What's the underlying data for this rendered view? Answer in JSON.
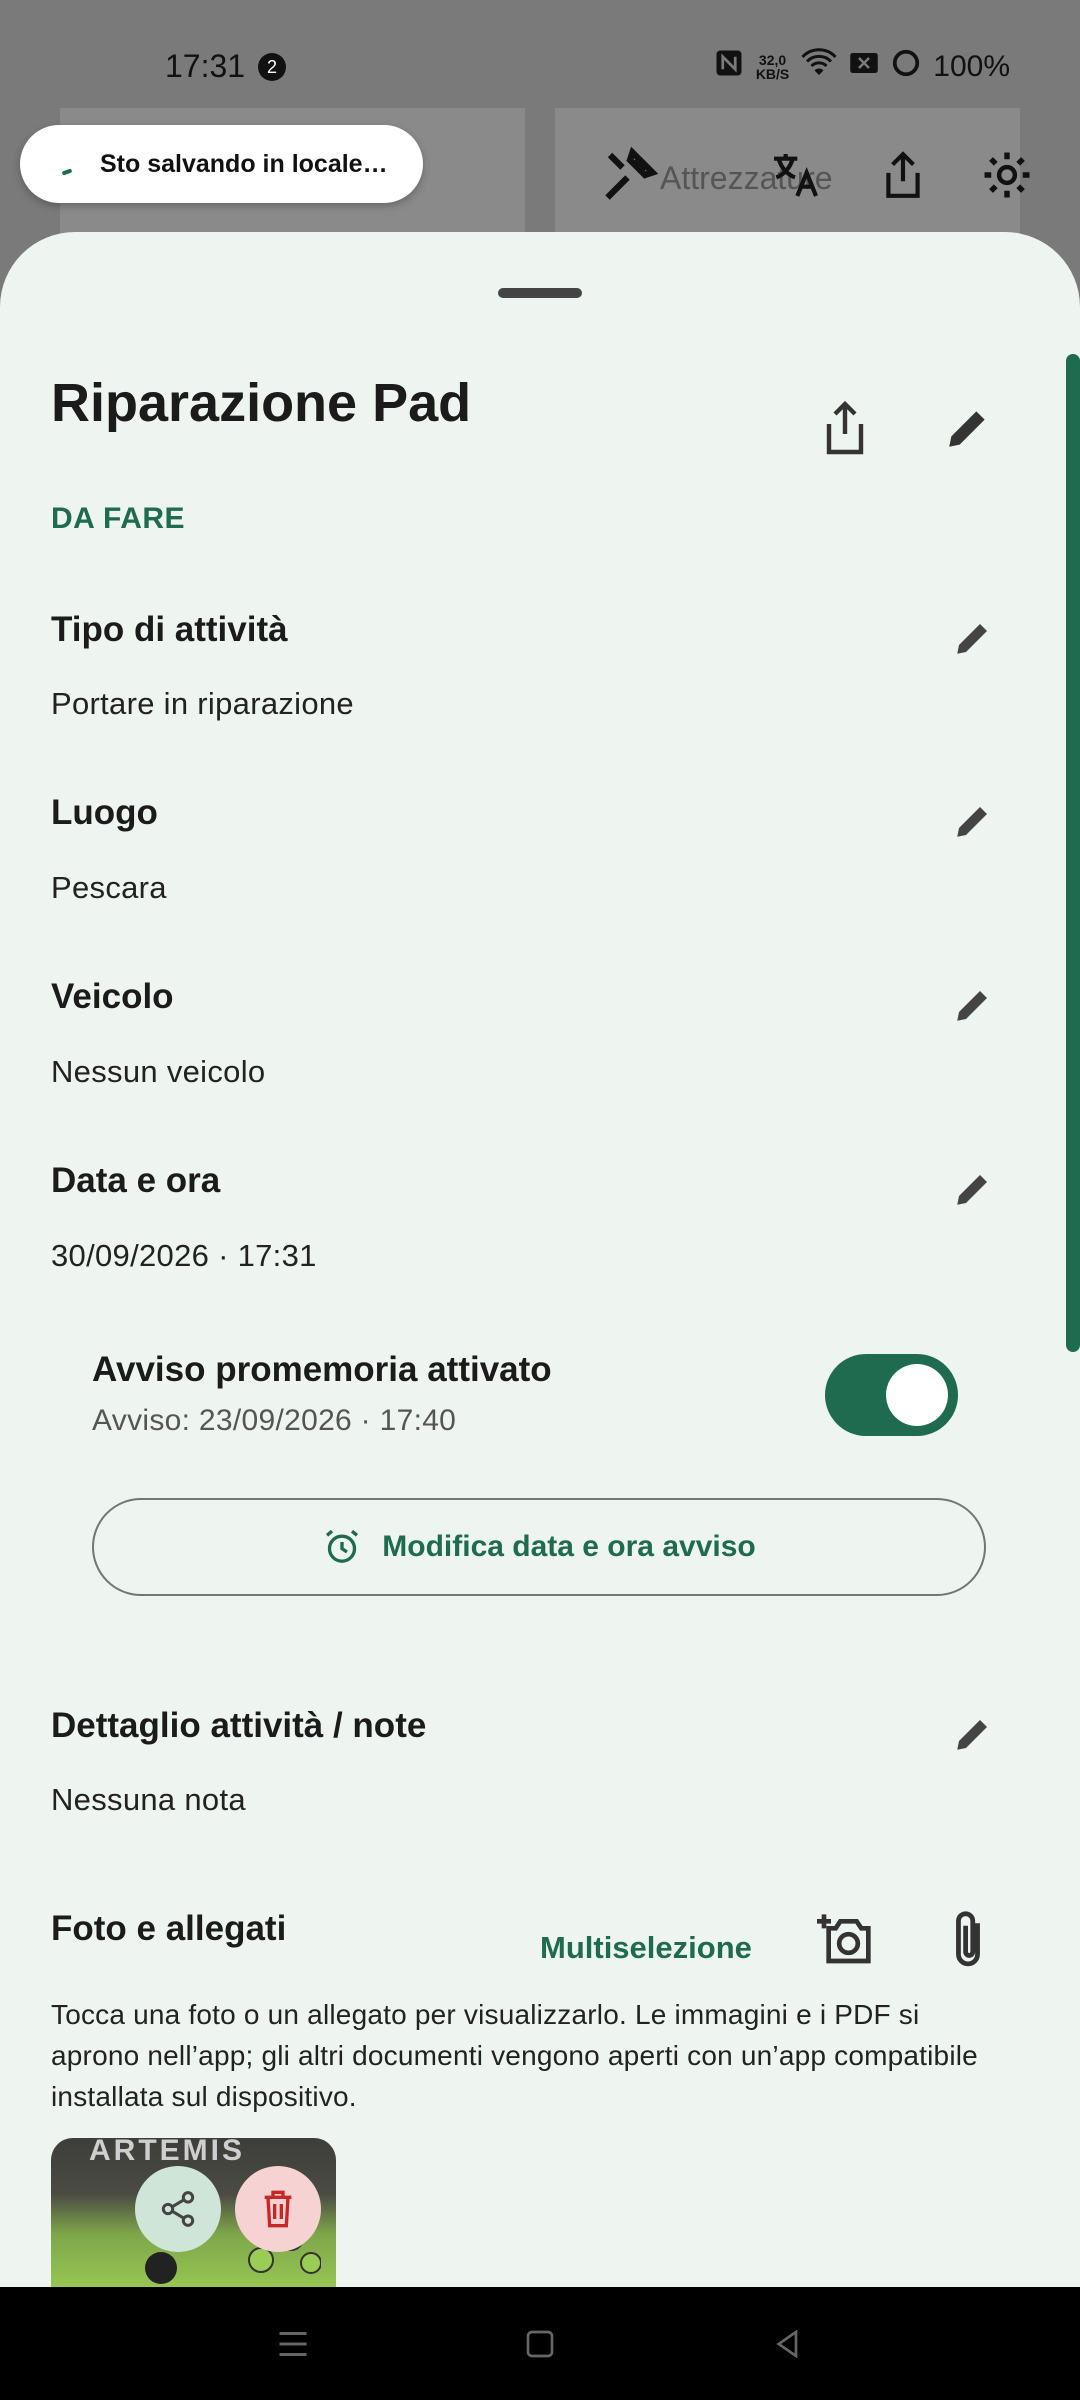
{
  "status_bar": {
    "time": "17:31",
    "notification_count": "2",
    "speed_value": "32,0",
    "speed_unit": "KB/S",
    "battery": "100%"
  },
  "background_app": {
    "partial_label": "Attrezzature"
  },
  "toast": {
    "text": "Sto salvando in locale…"
  },
  "activity": {
    "title": "Riparazione Pad",
    "status": "DA FARE",
    "sections": {
      "type": {
        "label": "Tipo di attività",
        "value": "Portare in riparazione"
      },
      "place": {
        "label": "Luogo",
        "value": "Pescara"
      },
      "vehicle": {
        "label": "Veicolo",
        "value": "Nessun veicolo"
      },
      "datetime": {
        "label": "Data e ora",
        "value": "30/09/2026 · 17:31"
      },
      "notes": {
        "label": "Dettaglio attività / note",
        "value": "Nessuna nota"
      }
    },
    "reminder": {
      "title": "Avviso promemoria attivato",
      "subtitle": "Avviso: 23/09/2026 · 17:40",
      "enabled": true,
      "edit_button": "Modifica data e ora avviso"
    },
    "attachments": {
      "label": "Foto e allegati",
      "multiselect": "Multiselezione",
      "help": "Tocca una foto o un allegato per visualizzarlo. Le immagini e i PDF si aprono nell’app; gli altri documenti vengono aperti con un’app compatibile installata sul dispositivo.",
      "thumbnail_text": "ARTEMIS"
    }
  },
  "colors": {
    "accent": "#1e6b4f",
    "sheet_bg": "#eef4ef",
    "delete": "#c62828"
  }
}
